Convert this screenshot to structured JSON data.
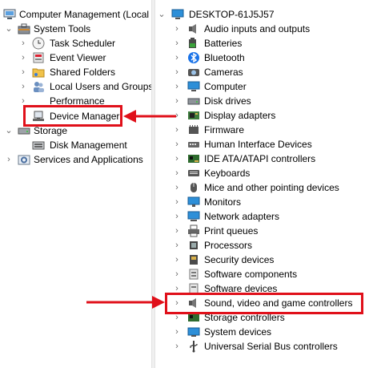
{
  "left_tree": {
    "root": "Computer Management (Local",
    "system_tools": "System Tools",
    "task_scheduler": "Task Scheduler",
    "event_viewer": "Event Viewer",
    "shared_folders": "Shared Folders",
    "local_users": "Local Users and Groups",
    "performance": "Performance",
    "device_manager": "Device Manager",
    "storage": "Storage",
    "disk_management": "Disk Management",
    "services": "Services and Applications"
  },
  "right_tree": {
    "computer_name": "DESKTOP-61J5J57",
    "categories": [
      "Audio inputs and outputs",
      "Batteries",
      "Bluetooth",
      "Cameras",
      "Computer",
      "Disk drives",
      "Display adapters",
      "Firmware",
      "Human Interface Devices",
      "IDE ATA/ATAPI controllers",
      "Keyboards",
      "Mice and other pointing devices",
      "Monitors",
      "Network adapters",
      "Print queues",
      "Processors",
      "Security devices",
      "Software components",
      "Software devices",
      "Sound, video and game controllers",
      "Storage controllers",
      "System devices",
      "Universal Serial Bus controllers"
    ]
  },
  "colors": {
    "highlight": "#e0101a",
    "bluetooth": "#1a73e8",
    "monitor": "#2d8fd8"
  },
  "icons": {
    "chevron_collapsed": "›",
    "chevron_expanded": "⌄"
  }
}
